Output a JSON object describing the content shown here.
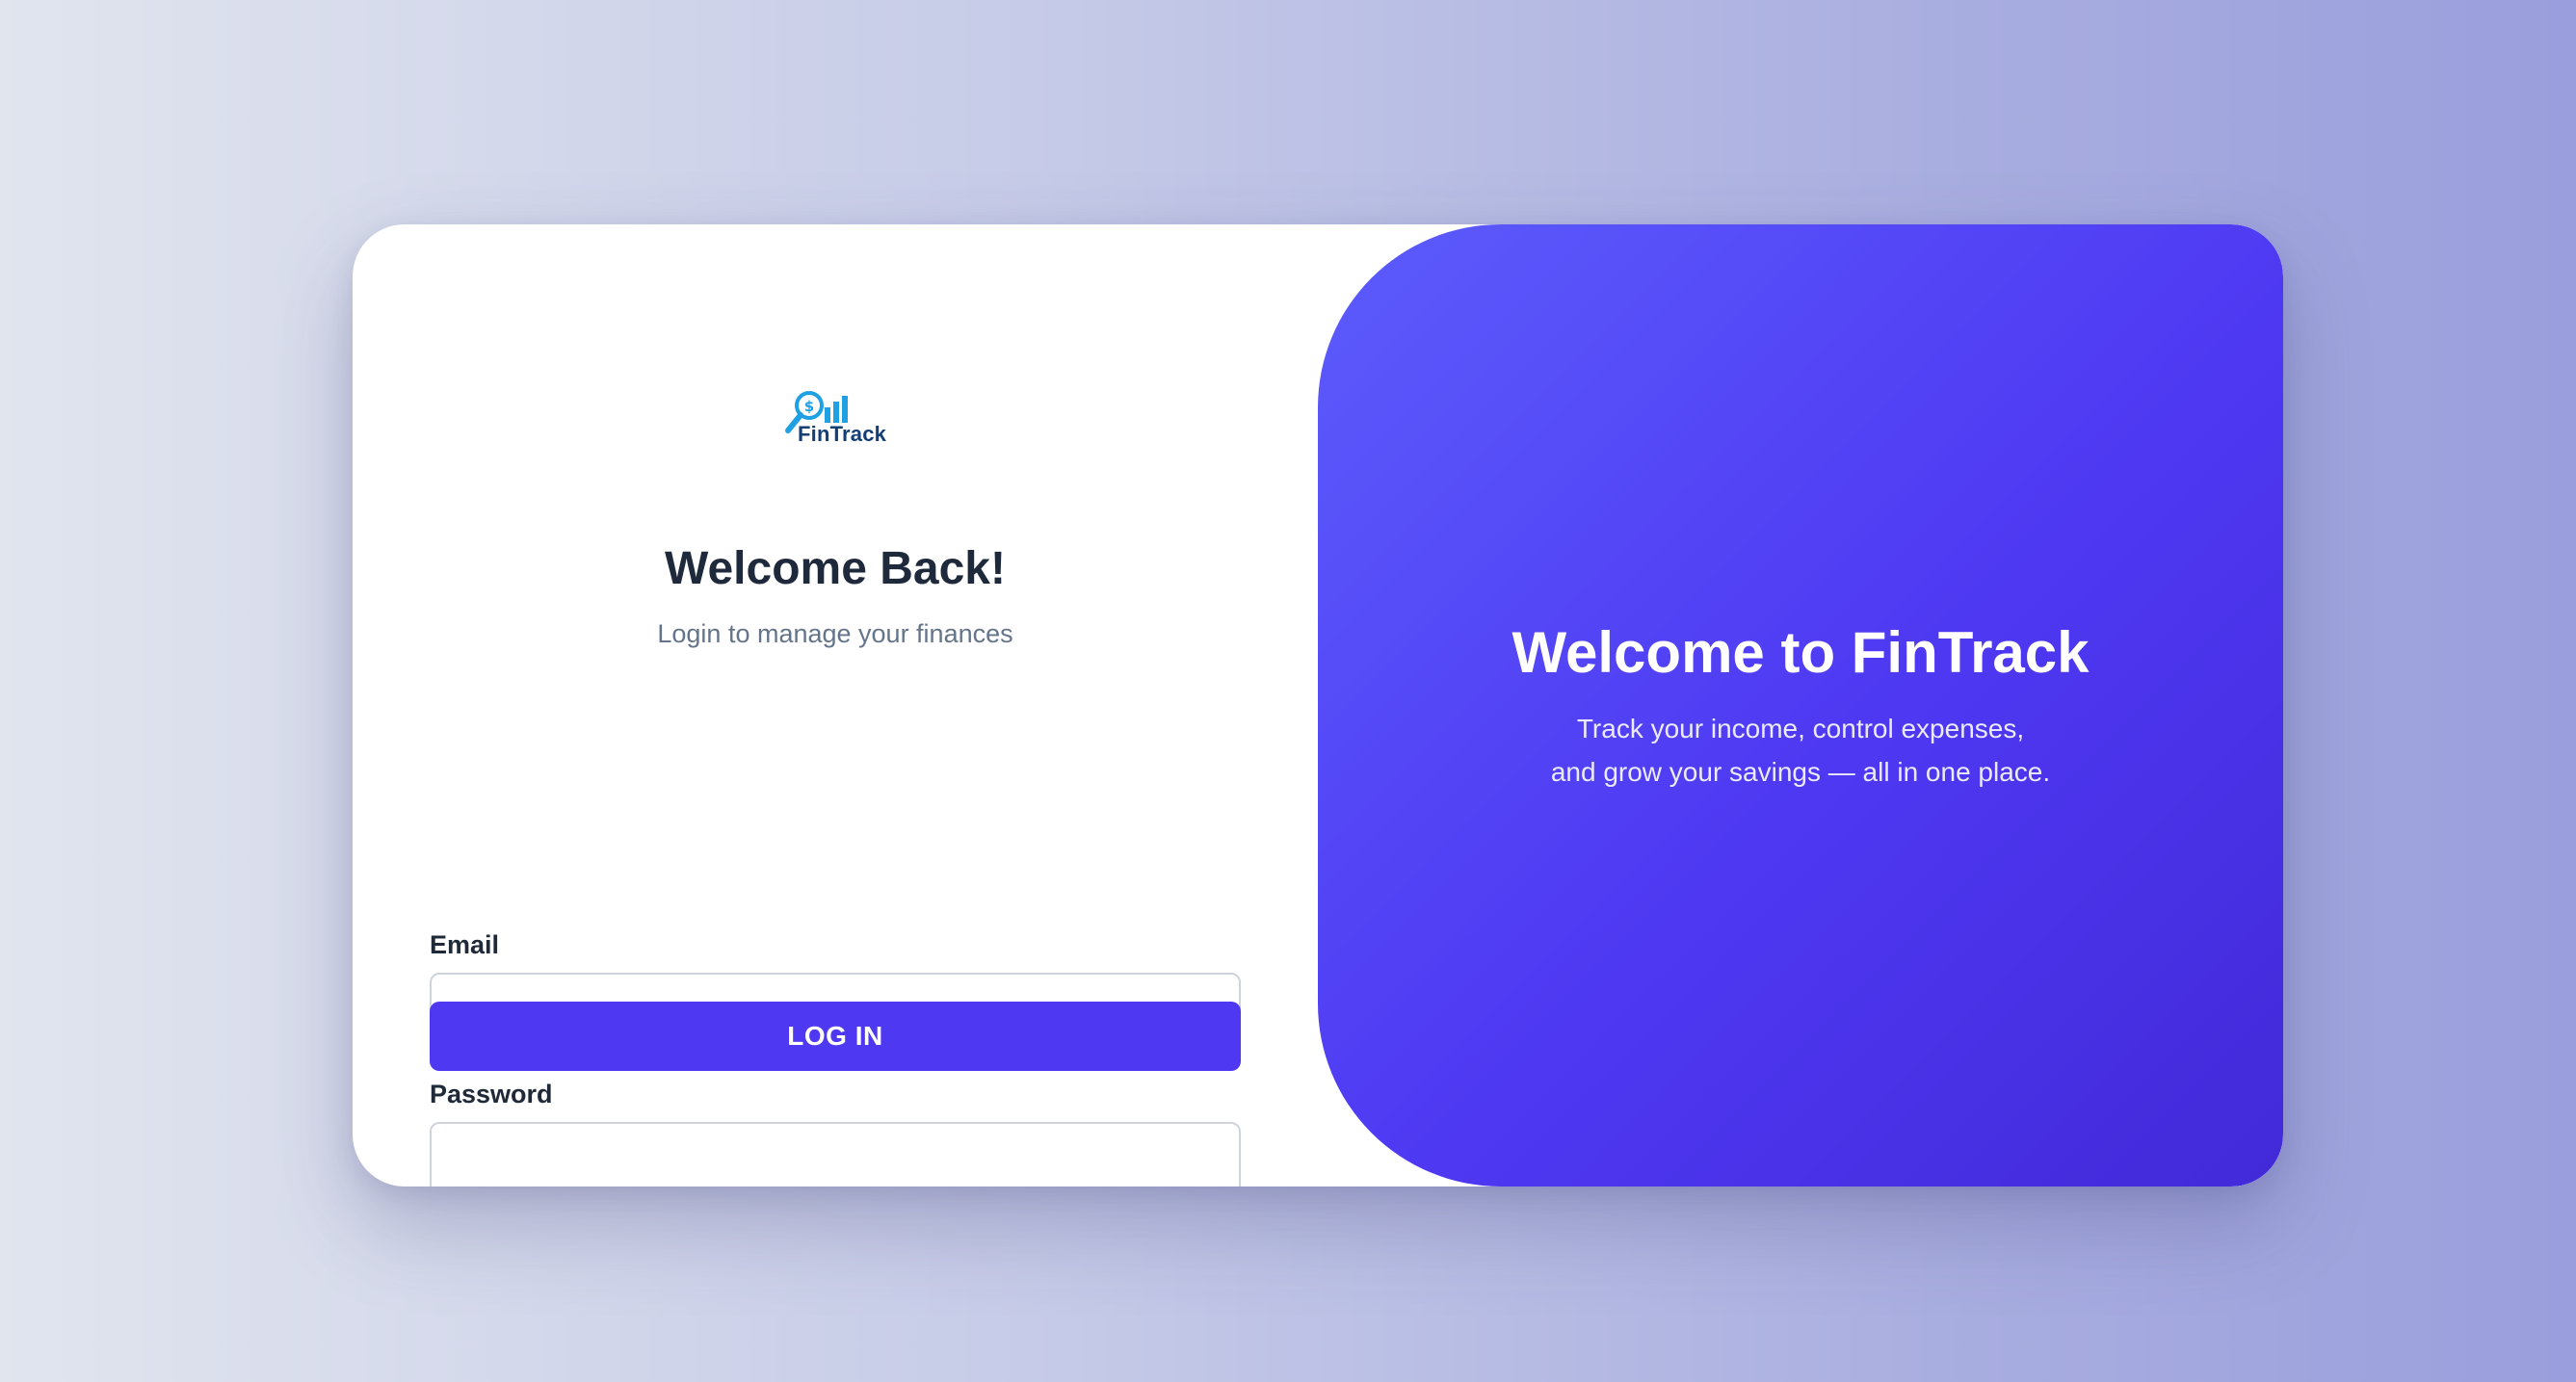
{
  "logo": {
    "text": "FinTrack",
    "icon": "magnifier-dollar-chart-icon",
    "colors": {
      "icon": "#1ea0e2",
      "text": "#133f74"
    }
  },
  "login": {
    "title": "Welcome Back!",
    "subtitle": "Login to manage your finances",
    "email_label": "Email",
    "email_value": "",
    "password_label": "Password",
    "password_value": "",
    "button_label": "LOG IN"
  },
  "promo": {
    "title": "Welcome to FinTrack",
    "line1": "Track your income, control expenses,",
    "line2": "and grow your savings — all in one place."
  },
  "colors": {
    "accent": "#4e38f2",
    "heading": "#1e293b",
    "muted": "#64748b"
  }
}
